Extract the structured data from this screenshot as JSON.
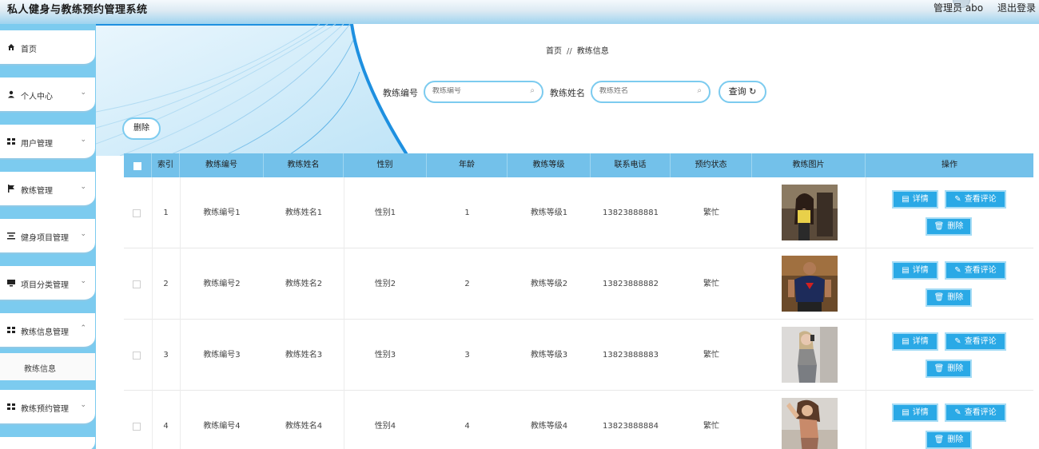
{
  "header": {
    "title": "私人健身与教练预约管理系统",
    "user": "管理员 abo",
    "logout": "退出登录"
  },
  "sidebar": {
    "items": [
      {
        "label": "首页",
        "icon": "home-icon",
        "has_arrow": false
      },
      {
        "label": "个人中心",
        "icon": "user-icon",
        "has_arrow": true
      },
      {
        "label": "用户管理",
        "icon": "grid-icon",
        "has_arrow": true
      },
      {
        "label": "教练管理",
        "icon": "flag-icon",
        "has_arrow": true
      },
      {
        "label": "健身项目管理",
        "icon": "list-icon",
        "has_arrow": true
      },
      {
        "label": "项目分类管理",
        "icon": "card-icon",
        "has_arrow": true
      },
      {
        "label": "教练信息管理",
        "icon": "grid-icon",
        "has_arrow": true
      },
      {
        "label": "教练预约管理",
        "icon": "grid-icon",
        "has_arrow": true
      }
    ],
    "submenu": {
      "label": "教练信息"
    }
  },
  "breadcrumb": {
    "home": "首页",
    "separator": "//",
    "current": "教练信息"
  },
  "search": {
    "field1": {
      "label": "教练编号",
      "placeholder": "教练编号"
    },
    "field2": {
      "label": "教练姓名",
      "placeholder": "教练姓名"
    },
    "query_label": "查询",
    "delete_label": "删除"
  },
  "table": {
    "headers": [
      "索引",
      "教练编号",
      "教练姓名",
      "性别",
      "年龄",
      "教练等级",
      "联系电话",
      "预约状态",
      "教练图片",
      "操作"
    ],
    "rows": [
      {
        "index": "1",
        "code": "教练编号1",
        "name": "教练姓名1",
        "gender": "性别1",
        "age": "1",
        "level": "教练等级1",
        "phone": "13823888881",
        "status": "繁忙"
      },
      {
        "index": "2",
        "code": "教练编号2",
        "name": "教练姓名2",
        "gender": "性别2",
        "age": "2",
        "level": "教练等级2",
        "phone": "13823888882",
        "status": "繁忙"
      },
      {
        "index": "3",
        "code": "教练编号3",
        "name": "教练姓名3",
        "gender": "性别3",
        "age": "3",
        "level": "教练等级3",
        "phone": "13823888883",
        "status": "繁忙"
      },
      {
        "index": "4",
        "code": "教练编号4",
        "name": "教练姓名4",
        "gender": "性别4",
        "age": "4",
        "level": "教练等级4",
        "phone": "13823888884",
        "status": "繁忙"
      }
    ],
    "actions": {
      "detail": "详情",
      "reviews": "查看评论",
      "delete": "删除"
    }
  },
  "colors": {
    "accent": "#2aa9e6",
    "sidebar": "#7ccbef",
    "table_header": "#73c1ea"
  }
}
